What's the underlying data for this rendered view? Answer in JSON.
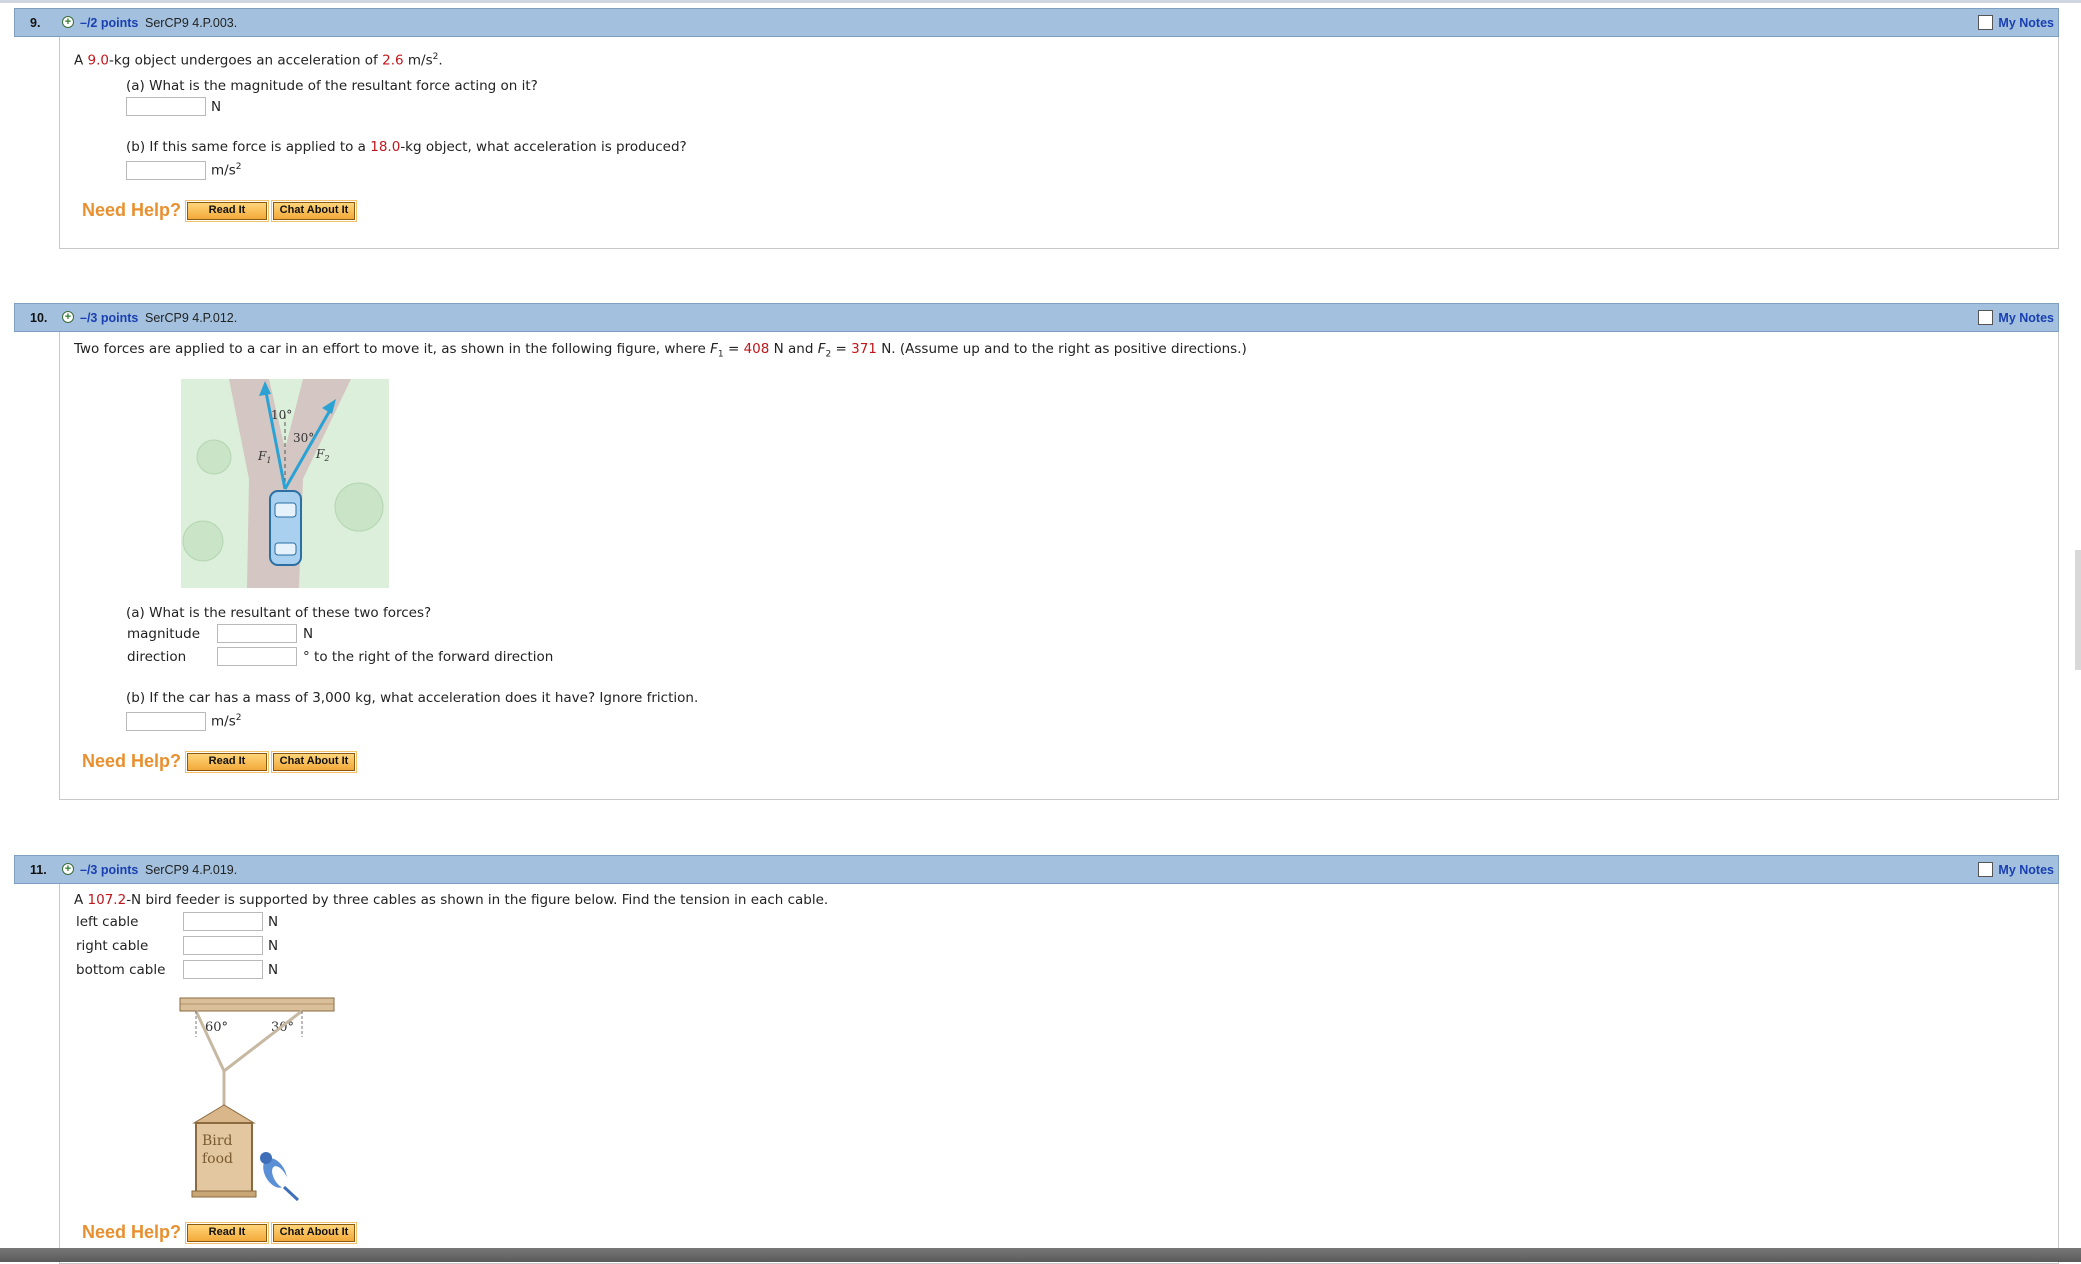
{
  "common": {
    "my_notes": "My Notes",
    "need_help": "Need Help?",
    "read_it": "Read It",
    "chat_about_it": "Chat About It",
    "plus": "+"
  },
  "q9": {
    "number": "9.",
    "points": "–/2 points",
    "code": "SerCP9 4.P.003.",
    "stem_pre": "A ",
    "mass": "9.0",
    "stem_mid": "-kg object undergoes an acceleration of ",
    "accel": "2.6",
    "stem_unit": "m/s",
    "stem_end": ".",
    "a_label": "(a) What is the magnitude of the resultant force acting on it?",
    "a_unit": "N",
    "b_pre": "(b) If this same force is applied to a ",
    "b_mass": "18.0",
    "b_post": "-kg object, what acceleration is produced?",
    "b_unit": "m/s",
    "sup2": "2",
    "answer_a": "",
    "answer_b": ""
  },
  "q10": {
    "number": "10.",
    "points": "–/3 points",
    "code": "SerCP9 4.P.012.",
    "stem_pre": "Two forces are applied to a car in an effort to move it, as shown in the following figure, where ",
    "F": "F",
    "sub1": "1",
    "sub2": "2",
    "eq": " = ",
    "f1": "408",
    "mid": " N and ",
    "f2": "371",
    "stem_end": " N. (Assume up and to the right as positive directions.)",
    "figure": {
      "angle1": "10°",
      "angle2": "30°",
      "label_f1": "F",
      "label_f2": "F",
      "sub1": "1",
      "sub2": "2"
    },
    "a_label": "(a) What is the resultant of these two forces?",
    "magnitude_label": "magnitude",
    "magnitude_unit": "N",
    "direction_label": "direction",
    "direction_unit": "° to the right of the forward direction",
    "b_label": "(b) If the car has a mass of 3,000 kg, what acceleration does it have? Ignore friction.",
    "b_unit": "m/s",
    "sup2": "2"
  },
  "q11": {
    "number": "11.",
    "points": "–/3 points",
    "code": "SerCP9 4.P.019.",
    "stem_pre": "A ",
    "weight": "107.2",
    "stem_post": "-N bird feeder is supported by three cables as shown in the figure below. Find the tension in each cable.",
    "rows": [
      {
        "label": "left cable",
        "unit": "N"
      },
      {
        "label": "right cable",
        "unit": "N"
      },
      {
        "label": "bottom cable",
        "unit": "N"
      }
    ],
    "figure": {
      "angle_left": "60°",
      "angle_right": "30°",
      "sign_line1": "Bird",
      "sign_line2": "food"
    }
  }
}
